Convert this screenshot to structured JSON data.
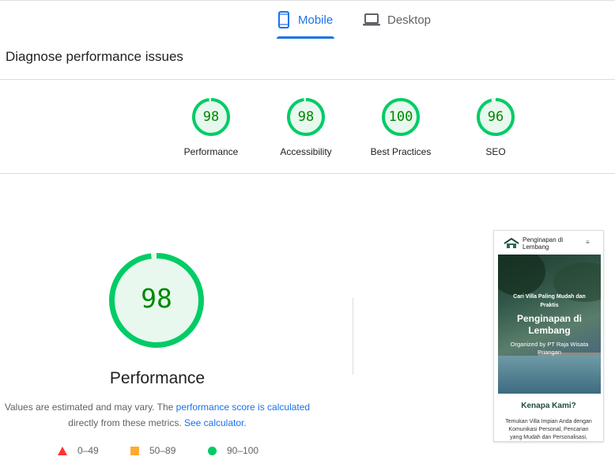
{
  "tabs": [
    {
      "label": "Mobile",
      "icon": "smartphone-icon",
      "selected": true
    },
    {
      "label": "Desktop",
      "icon": "laptop-icon",
      "selected": false
    }
  ],
  "section_title": "Diagnose performance issues",
  "categories": [
    {
      "label": "Performance",
      "score": 98
    },
    {
      "label": "Accessibility",
      "score": 98
    },
    {
      "label": "Best Practices",
      "score": 100
    },
    {
      "label": "SEO",
      "score": 96
    }
  ],
  "main": {
    "score": 98,
    "title": "Performance",
    "note_prefix": "Values are estimated and may vary. The ",
    "note_link1": "performance score is calculated",
    "note_mid": " directly from these metrics. ",
    "note_link2": "See calculator",
    "note_suffix": "."
  },
  "legend": [
    {
      "range": "0–49",
      "shape": "triangle",
      "color": "#ff3333"
    },
    {
      "range": "50–89",
      "shape": "square",
      "color": "#ffaa33"
    },
    {
      "range": "90–100",
      "shape": "circle",
      "color": "#00cc66"
    }
  ],
  "screenshot": {
    "brand_line1": "Penginapan di",
    "brand_line2": "Lembang",
    "menu_icon": "≡",
    "hero_tagline1": "Cari Villa Paling Mudah dan",
    "hero_tagline2": "Praktis",
    "hero_title1": "Penginapan di",
    "hero_title2": "Lembang",
    "hero_org1": "Organized by PT Raja Wisata",
    "hero_org2": "Priangan",
    "heading": "Kenapa Kami?",
    "para1": "Temukan Villa Impian Anda dengan",
    "para2": "Komunikasi Personal, Pencarian",
    "para3": "yang Mudah dan Personalisasi,"
  },
  "colors": {
    "accent": "#1a73e8",
    "pass_green": "#00cc66",
    "pass_text": "#008800",
    "pass_fill": "#e8f8ee"
  }
}
